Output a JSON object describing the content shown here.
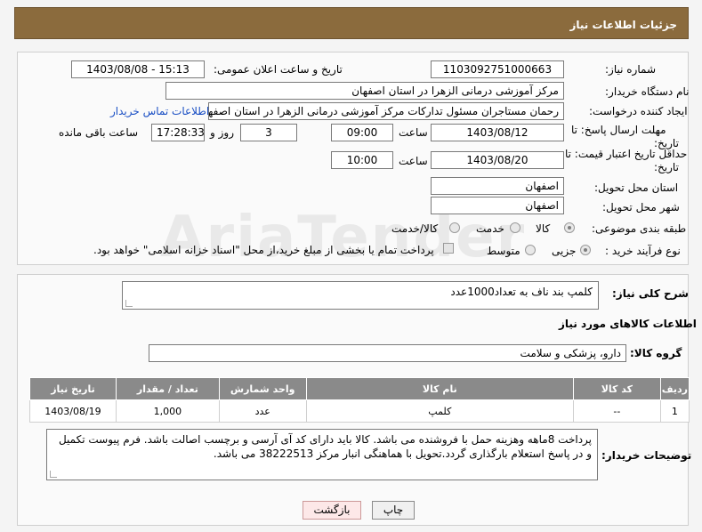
{
  "header": {
    "title": "جزئیات اطلاعات نیاز"
  },
  "fields": {
    "need_number_label": "شماره نیاز:",
    "need_number": "1103092751000663",
    "announce_label": "تاریخ و ساعت اعلان عمومی:",
    "announce_value": "1403/08/08 - 15:13",
    "buyer_org_label": "نام دستگاه خریدار:",
    "buyer_org": "مرکز آموزشی درمانی الزهرا در استان اصفهان",
    "creator_label": "ایجاد کننده درخواست:",
    "creator": "رحمان مستاجران مسئول تدارکات مرکز آموزشی درمانی الزهرا در استان اصفهان",
    "contact_link": "اطلاعات تماس خریدار",
    "deadline_label_1": "مهلت ارسال پاسخ: تا",
    "deadline_label_2": "تاریخ:",
    "deadline_date": "1403/08/12",
    "time_label": "ساعت",
    "deadline_time": "09:00",
    "days_value": "3",
    "days_label": "روز و",
    "remaining_time": "17:28:33",
    "remaining_label": "ساعت باقی مانده",
    "validity_label_1": "حداقل تاریخ اعتبار قیمت: تا",
    "validity_label_2": "تاریخ:",
    "validity_date": "1403/08/20",
    "validity_time": "10:00",
    "province_label": "استان محل تحویل:",
    "province": "اصفهان",
    "city_label": "شهر محل تحویل:",
    "city": "اصفهان",
    "category_label": "طبقه بندی موضوعی:",
    "category_options": [
      "کالا",
      "خدمت",
      "کالا/خدمت"
    ],
    "process_label": "نوع فرآیند خرید :",
    "process_options": [
      "جزیی",
      "متوسط"
    ],
    "payment_note": "پرداخت تمام یا بخشی از مبلغ خرید،از محل \"اسناد خزانه اسلامی\" خواهد بود."
  },
  "description": {
    "label": "شرح کلی نیاز:",
    "value": "کلمپ بند ناف به تعداد1000عدد"
  },
  "goods_info_title": "اطلاعات کالاهای مورد نیاز",
  "goods_group": {
    "label": "گروه کالا:",
    "value": "دارو، پزشکی و سلامت"
  },
  "table": {
    "headers": [
      "ردیف",
      "کد کالا",
      "نام کالا",
      "واحد شمارش",
      "تعداد / مقدار",
      "تاریخ نیاز"
    ],
    "rows": [
      [
        "1",
        "--",
        "کلمپ",
        "عدد",
        "1,000",
        "1403/08/19"
      ]
    ]
  },
  "buyer_notes": {
    "label": "توضیحات خریدار:",
    "value": "پرداخت 8ماهه وهزینه حمل با فروشنده می باشد. کالا باید دارای کد آی آرسی و برچسب اصالت باشد. فرم پیوست تکمیل و در پاسخ استعلام بارگذاری گردد.تحویل با هماهنگی انبار مرکز 38222513 می باشد."
  },
  "buttons": {
    "print": "چاپ",
    "back": "بازگشت"
  },
  "colors": {
    "header": "#8b6b3d",
    "table_header": "#8a8a8a",
    "link": "#1a4fc4"
  }
}
